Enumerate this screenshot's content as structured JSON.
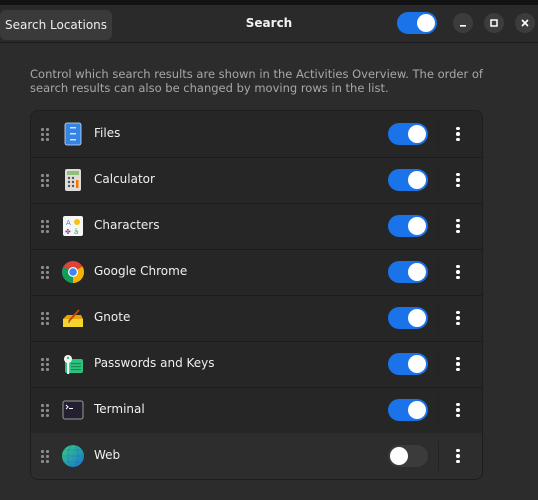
{
  "header": {
    "search_locations_label": "Search Locations",
    "title": "Search",
    "search_enabled": true,
    "minimize_icon": "minimize-icon",
    "maximize_icon": "maximize-icon",
    "close_icon": "close-icon"
  },
  "description": "Control which search results are shown in the Activities Overview. The order of search results can also be changed by moving rows in the list.",
  "accent_color": "#1a73e8",
  "providers": [
    {
      "label": "Files",
      "icon": "files-icon",
      "enabled": true
    },
    {
      "label": "Calculator",
      "icon": "calculator-icon",
      "enabled": true
    },
    {
      "label": "Characters",
      "icon": "characters-icon",
      "enabled": true
    },
    {
      "label": "Google Chrome",
      "icon": "chrome-icon",
      "enabled": true
    },
    {
      "label": "Gnote",
      "icon": "gnote-icon",
      "enabled": true
    },
    {
      "label": "Passwords and Keys",
      "icon": "passwords-keys-icon",
      "enabled": true
    },
    {
      "label": "Terminal",
      "icon": "terminal-icon",
      "enabled": true
    },
    {
      "label": "Web",
      "icon": "web-icon",
      "enabled": false
    }
  ]
}
